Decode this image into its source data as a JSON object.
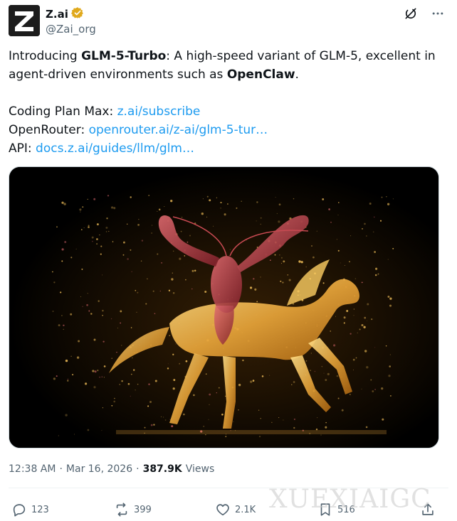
{
  "author": {
    "display_name": "Z.ai",
    "handle": "@Zai_org",
    "avatar_letter": "Z",
    "verified_color": "#e0a91c"
  },
  "header_icons": [
    "grok-icon",
    "more-icon"
  ],
  "text": {
    "intro_prefix": "Introducing ",
    "model_name": "GLM-5-Turbo",
    "intro_middle": ": A high-speed variant of GLM-5, excellent in agent-driven environments such as ",
    "openclaw": "OpenClaw",
    "intro_suffix": ".",
    "line1_label": "Coding Plan Max: ",
    "line1_link": "z.ai/subscribe",
    "line2_label": "OpenRouter: ",
    "line2_link": "openrouter.ai/z-ai/glm-5-tur…",
    "line3_label": "API: ",
    "line3_link": "docs.z.ai/guides/llm/glm…"
  },
  "meta": {
    "time": "12:38 AM",
    "separator": "·",
    "date": "Mar 16, 2026",
    "views_count": "387.9K",
    "views_label": "Views"
  },
  "actions": {
    "replies": "123",
    "reposts": "399",
    "likes": "2.1K",
    "bookmarks": "516"
  },
  "watermark": "XUEXIAIGC",
  "colors": {
    "link": "#1d9bf0",
    "secondary": "#536471",
    "gold": "#e8a53a",
    "lobster": "#b6434a"
  }
}
